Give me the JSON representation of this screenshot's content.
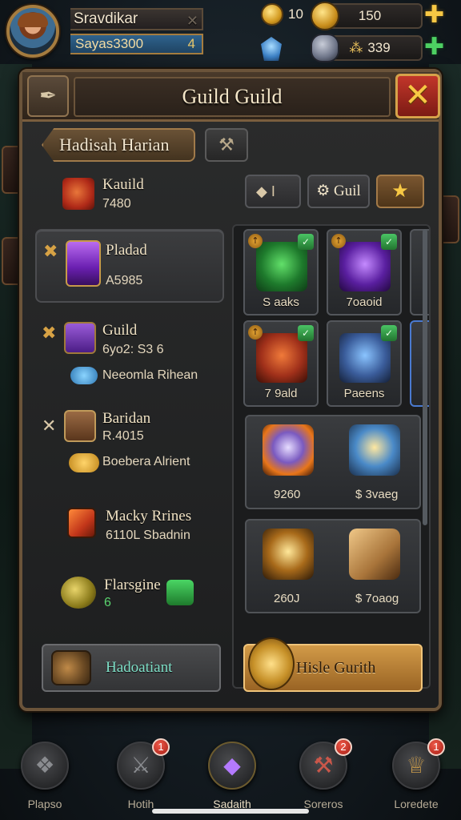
{
  "player": {
    "name": "Sravdikar",
    "name_close": "✕",
    "subtitle": "Sayas3300",
    "level": "4"
  },
  "currencies": {
    "small_coin_value": "10",
    "gold_value": "150",
    "ore_symbol": "⁂",
    "ore_value": "339",
    "gold_add": "✚",
    "ore_add": "✚"
  },
  "panel": {
    "title": "Guild Guild",
    "close_symbol": "✕",
    "active_subtab": "Hadisah Harian"
  },
  "list": {
    "items": [
      {
        "title": "Kauild",
        "sub": "7480"
      },
      {
        "title": "Pladad",
        "sub": "A5985",
        "selected": true
      },
      {
        "title": "Guild",
        "sub": "6yo2: S3 6",
        "sub2": "Neeomla Rihean"
      },
      {
        "title": "Baridan",
        "sub": "R.4015",
        "sub2": "Boebera Alrient"
      },
      {
        "title": "Macky Rrines",
        "sub": "6110L Sbadnin"
      },
      {
        "title": "Flarsgine",
        "sub": "6"
      }
    ],
    "bottom_button": "Hadoatiant"
  },
  "filters": {
    "filter1": "I",
    "filter2": "Guil",
    "filter3": "★"
  },
  "grid": {
    "cards": [
      {
        "label": "S aaks"
      },
      {
        "label": "7oaoid"
      },
      {
        "label": "7 9ald"
      },
      {
        "label": "Paeens"
      }
    ],
    "big_cards": [
      {
        "v1": "9260",
        "v2": "$ 3vaeg"
      },
      {
        "v1": "260J",
        "v2": "$ 7oaog"
      }
    ],
    "bottom_button": "Hisle Gurith"
  },
  "nav": {
    "items": [
      {
        "label": "Plapso",
        "badge": ""
      },
      {
        "label": "Hotih",
        "badge": "1"
      },
      {
        "label": "Sadaith",
        "badge": ""
      },
      {
        "label": "Soreros",
        "badge": "2"
      },
      {
        "label": "Loredete",
        "badge": "1"
      }
    ]
  },
  "colors": {
    "accent_gold": "#f7c844",
    "close_red": "#c2362a",
    "panel_bg": "#2b2c2c",
    "frame_bronze": "#6b543a"
  }
}
